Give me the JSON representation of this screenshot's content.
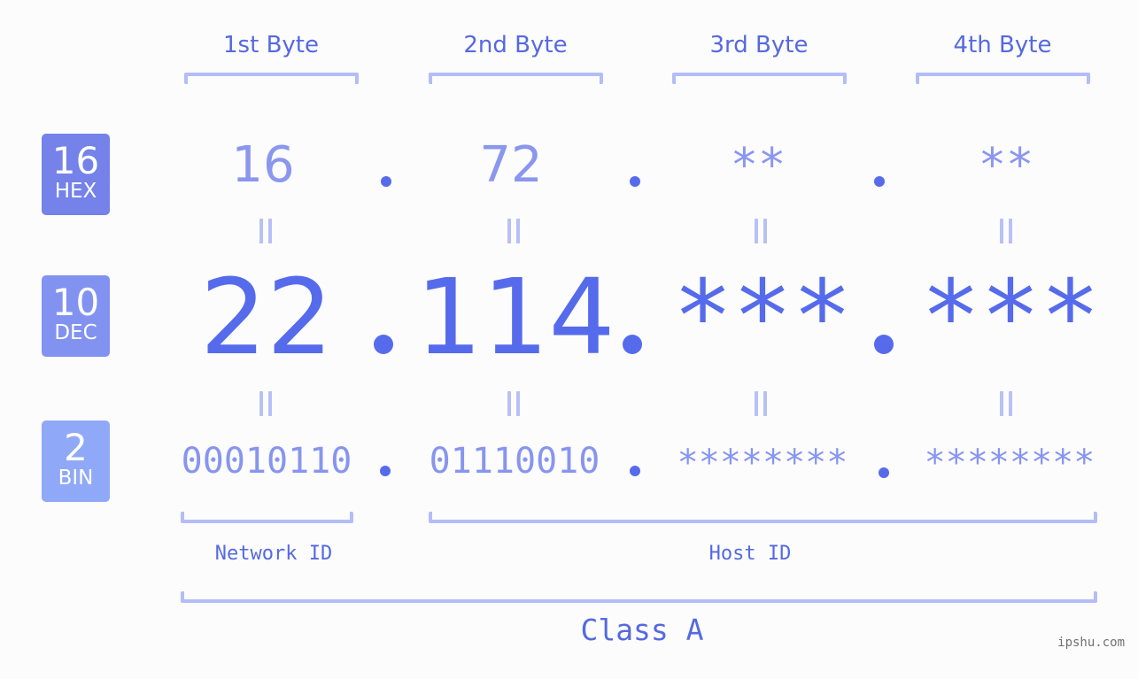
{
  "bases": [
    {
      "number": "16",
      "label": "HEX",
      "color": "#7482ea"
    },
    {
      "number": "10",
      "label": "DEC",
      "color": "#8292f1"
    },
    {
      "number": "2",
      "label": "BIN",
      "color": "#90a8f8"
    }
  ],
  "bytes": [
    {
      "label": "1st Byte",
      "hex": "16",
      "dec": "22",
      "bin": "00010110"
    },
    {
      "label": "2nd Byte",
      "hex": "72",
      "dec": "114",
      "bin": "01110010"
    },
    {
      "label": "3rd Byte",
      "hex": "**",
      "dec": "***",
      "bin": "********"
    },
    {
      "label": "4th Byte",
      "hex": "**",
      "dec": "***",
      "bin": "********"
    }
  ],
  "ip_address": "22.114.***.***",
  "network_id_label": "Network ID",
  "host_id_label": "Host ID",
  "class_label": "Class A",
  "watermark": "ipshu.com",
  "colors": {
    "accent": "#566bec",
    "label": "#5569e2",
    "bracket": "#b3bdf8",
    "equals": "#b8c1f6",
    "background": "#fbfcfb"
  }
}
